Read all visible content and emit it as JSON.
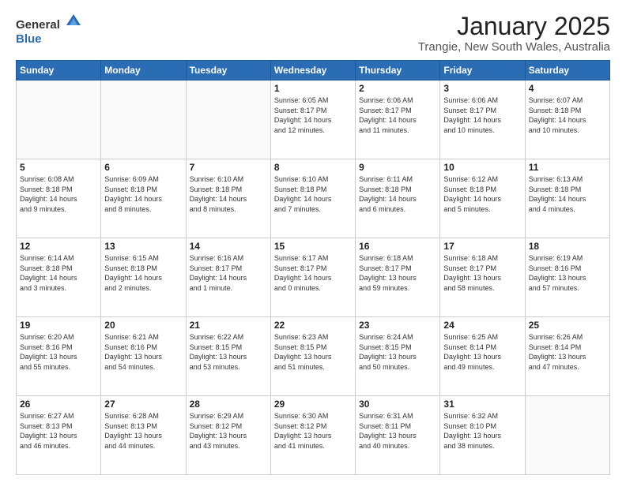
{
  "header": {
    "logo_general": "General",
    "logo_blue": "Blue",
    "title": "January 2025",
    "subtitle": "Trangie, New South Wales, Australia"
  },
  "days_of_week": [
    "Sunday",
    "Monday",
    "Tuesday",
    "Wednesday",
    "Thursday",
    "Friday",
    "Saturday"
  ],
  "weeks": [
    [
      {
        "day": "",
        "details": ""
      },
      {
        "day": "",
        "details": ""
      },
      {
        "day": "",
        "details": ""
      },
      {
        "day": "1",
        "details": "Sunrise: 6:05 AM\nSunset: 8:17 PM\nDaylight: 14 hours\nand 12 minutes."
      },
      {
        "day": "2",
        "details": "Sunrise: 6:06 AM\nSunset: 8:17 PM\nDaylight: 14 hours\nand 11 minutes."
      },
      {
        "day": "3",
        "details": "Sunrise: 6:06 AM\nSunset: 8:17 PM\nDaylight: 14 hours\nand 10 minutes."
      },
      {
        "day": "4",
        "details": "Sunrise: 6:07 AM\nSunset: 8:18 PM\nDaylight: 14 hours\nand 10 minutes."
      }
    ],
    [
      {
        "day": "5",
        "details": "Sunrise: 6:08 AM\nSunset: 8:18 PM\nDaylight: 14 hours\nand 9 minutes."
      },
      {
        "day": "6",
        "details": "Sunrise: 6:09 AM\nSunset: 8:18 PM\nDaylight: 14 hours\nand 8 minutes."
      },
      {
        "day": "7",
        "details": "Sunrise: 6:10 AM\nSunset: 8:18 PM\nDaylight: 14 hours\nand 8 minutes."
      },
      {
        "day": "8",
        "details": "Sunrise: 6:10 AM\nSunset: 8:18 PM\nDaylight: 14 hours\nand 7 minutes."
      },
      {
        "day": "9",
        "details": "Sunrise: 6:11 AM\nSunset: 8:18 PM\nDaylight: 14 hours\nand 6 minutes."
      },
      {
        "day": "10",
        "details": "Sunrise: 6:12 AM\nSunset: 8:18 PM\nDaylight: 14 hours\nand 5 minutes."
      },
      {
        "day": "11",
        "details": "Sunrise: 6:13 AM\nSunset: 8:18 PM\nDaylight: 14 hours\nand 4 minutes."
      }
    ],
    [
      {
        "day": "12",
        "details": "Sunrise: 6:14 AM\nSunset: 8:18 PM\nDaylight: 14 hours\nand 3 minutes."
      },
      {
        "day": "13",
        "details": "Sunrise: 6:15 AM\nSunset: 8:18 PM\nDaylight: 14 hours\nand 2 minutes."
      },
      {
        "day": "14",
        "details": "Sunrise: 6:16 AM\nSunset: 8:17 PM\nDaylight: 14 hours\nand 1 minute."
      },
      {
        "day": "15",
        "details": "Sunrise: 6:17 AM\nSunset: 8:17 PM\nDaylight: 14 hours\nand 0 minutes."
      },
      {
        "day": "16",
        "details": "Sunrise: 6:18 AM\nSunset: 8:17 PM\nDaylight: 13 hours\nand 59 minutes."
      },
      {
        "day": "17",
        "details": "Sunrise: 6:18 AM\nSunset: 8:17 PM\nDaylight: 13 hours\nand 58 minutes."
      },
      {
        "day": "18",
        "details": "Sunrise: 6:19 AM\nSunset: 8:16 PM\nDaylight: 13 hours\nand 57 minutes."
      }
    ],
    [
      {
        "day": "19",
        "details": "Sunrise: 6:20 AM\nSunset: 8:16 PM\nDaylight: 13 hours\nand 55 minutes."
      },
      {
        "day": "20",
        "details": "Sunrise: 6:21 AM\nSunset: 8:16 PM\nDaylight: 13 hours\nand 54 minutes."
      },
      {
        "day": "21",
        "details": "Sunrise: 6:22 AM\nSunset: 8:15 PM\nDaylight: 13 hours\nand 53 minutes."
      },
      {
        "day": "22",
        "details": "Sunrise: 6:23 AM\nSunset: 8:15 PM\nDaylight: 13 hours\nand 51 minutes."
      },
      {
        "day": "23",
        "details": "Sunrise: 6:24 AM\nSunset: 8:15 PM\nDaylight: 13 hours\nand 50 minutes."
      },
      {
        "day": "24",
        "details": "Sunrise: 6:25 AM\nSunset: 8:14 PM\nDaylight: 13 hours\nand 49 minutes."
      },
      {
        "day": "25",
        "details": "Sunrise: 6:26 AM\nSunset: 8:14 PM\nDaylight: 13 hours\nand 47 minutes."
      }
    ],
    [
      {
        "day": "26",
        "details": "Sunrise: 6:27 AM\nSunset: 8:13 PM\nDaylight: 13 hours\nand 46 minutes."
      },
      {
        "day": "27",
        "details": "Sunrise: 6:28 AM\nSunset: 8:13 PM\nDaylight: 13 hours\nand 44 minutes."
      },
      {
        "day": "28",
        "details": "Sunrise: 6:29 AM\nSunset: 8:12 PM\nDaylight: 13 hours\nand 43 minutes."
      },
      {
        "day": "29",
        "details": "Sunrise: 6:30 AM\nSunset: 8:12 PM\nDaylight: 13 hours\nand 41 minutes."
      },
      {
        "day": "30",
        "details": "Sunrise: 6:31 AM\nSunset: 8:11 PM\nDaylight: 13 hours\nand 40 minutes."
      },
      {
        "day": "31",
        "details": "Sunrise: 6:32 AM\nSunset: 8:10 PM\nDaylight: 13 hours\nand 38 minutes."
      },
      {
        "day": "",
        "details": ""
      }
    ]
  ]
}
